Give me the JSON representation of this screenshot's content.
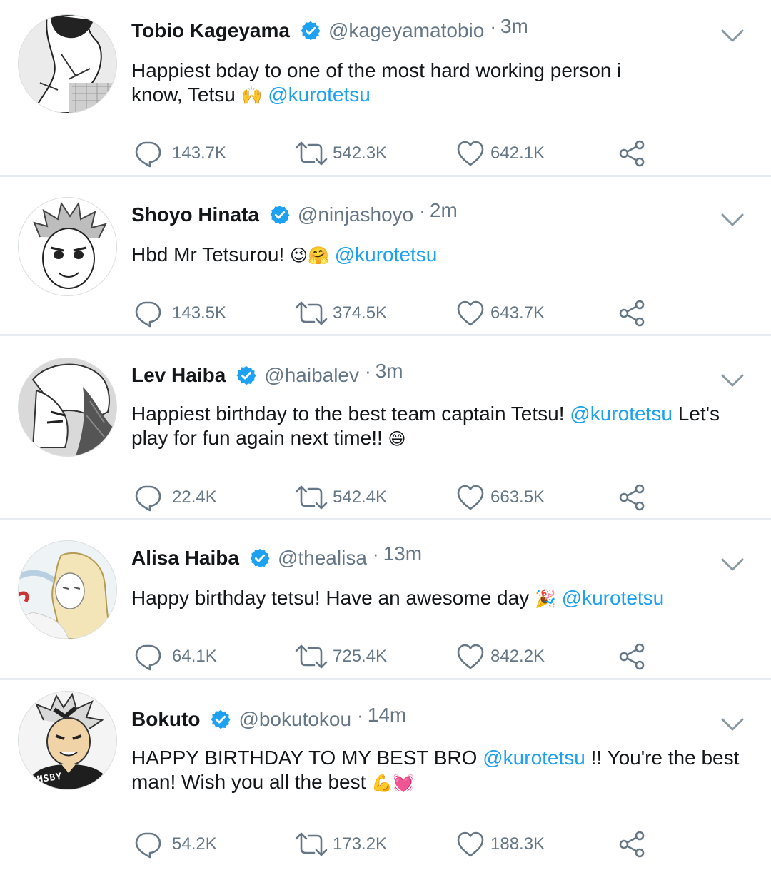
{
  "tweets": [
    {
      "name": "Tobio Kageyama",
      "handle": "@kageyamatobio",
      "dot": "·",
      "time": "3m",
      "text_lines": [
        "Happiest bday to one of the most hard working person i",
        "know, Tetsu"
      ],
      "emoji": "🙌",
      "mention": "@kurotetsu",
      "replies": "143.7K",
      "retweets": "542.3K",
      "likes": "642.1K"
    },
    {
      "name": "Shoyo Hinata",
      "handle": "@ninjashoyo",
      "dot": "·",
      "time": "2m",
      "text": "Hbd Mr Tetsurou!",
      "emoji": "😉🤗",
      "mention": "@kurotetsu",
      "replies": "143.5K",
      "retweets": "374.5K",
      "likes": "643.7K"
    },
    {
      "name": "Lev Haiba",
      "handle": "@haibalev",
      "dot": "·",
      "time": "3m",
      "text_before": "Happiest birthday to the best team captain Tetsu!",
      "mention": "@kurotetsu",
      "text_after": "Let's",
      "text_line2": "play for fun again next time!!",
      "emoji": "😄",
      "replies": "22.4K",
      "retweets": "542.4K",
      "likes": "663.5K"
    },
    {
      "name": "Alisa Haiba",
      "handle": "@thealisa",
      "dot": "·",
      "time": "13m",
      "text": "Happy birthday tetsu! Have an awesome day",
      "emoji": "🎉",
      "mention": "@kurotetsu",
      "replies": "64.1K",
      "retweets": "725.4K",
      "likes": "842.2K"
    },
    {
      "name": "Bokuto",
      "handle": "@bokutokou",
      "dot": "·",
      "time": "14m",
      "text_before": "HAPPY BIRTHDAY TO MY BEST BRO",
      "mention": "@kurotetsu",
      "text_after": "!! You're the best",
      "text_line2": "man! Wish you all the best",
      "emoji": "💪💓",
      "avatar_badge": "MSBY",
      "replies": "54.2K",
      "retweets": "173.2K",
      "likes": "188.3K"
    }
  ],
  "icons": {
    "verified": "verified-badge-icon",
    "caret": "chevron-down-icon",
    "reply": "reply-bubble-icon",
    "retweet": "retweet-icon",
    "like": "heart-icon",
    "share": "share-icon"
  },
  "colors": {
    "accent": "#1da1f2",
    "muted": "#657786",
    "text": "#14171a",
    "divider": "#e6ecf0"
  }
}
